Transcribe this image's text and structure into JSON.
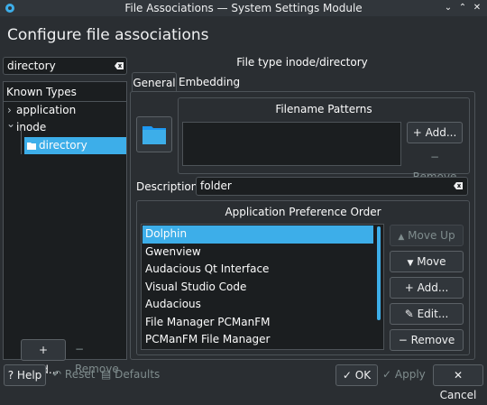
{
  "window": {
    "title": "File Associations — System Settings Module"
  },
  "header": {
    "title": "Configure file associations"
  },
  "search": {
    "value": "directory"
  },
  "known_types": {
    "heading": "Known Types",
    "items": [
      {
        "label": "application",
        "arrow": "›"
      },
      {
        "label": "inode",
        "arrow": "⌄"
      },
      {
        "label": "directory"
      }
    ],
    "add_label": "+ Add...",
    "remove_label": "− Remove"
  },
  "filetype": {
    "label": "File type inode/directory"
  },
  "tabs": [
    {
      "label": "General"
    },
    {
      "label": "Embedding"
    }
  ],
  "patterns": {
    "title": "Filename Patterns",
    "add_label": "+ Add...",
    "remove_label": "− Remove"
  },
  "description": {
    "label": "Description:",
    "value": "folder"
  },
  "apo": {
    "title": "Application Preference Order",
    "items": [
      "Dolphin",
      "Gwenview",
      "Audacious Qt Interface",
      "Visual Studio Code",
      "Audacious",
      "File Manager PCManFM",
      "PCManFM File Manager"
    ],
    "move_up": "Move Up",
    "move_down": "Move Down",
    "add": "+ Add...",
    "edit": "Edit...",
    "remove": "− Remove"
  },
  "footer": {
    "help": "Help",
    "reset": "Reset",
    "defaults": "Defaults",
    "ok": "OK",
    "apply": "Apply",
    "cancel": "Cancel"
  },
  "colors": {
    "accent": "#3daee9",
    "window": "#2a2e32",
    "view": "#1b1e20"
  }
}
